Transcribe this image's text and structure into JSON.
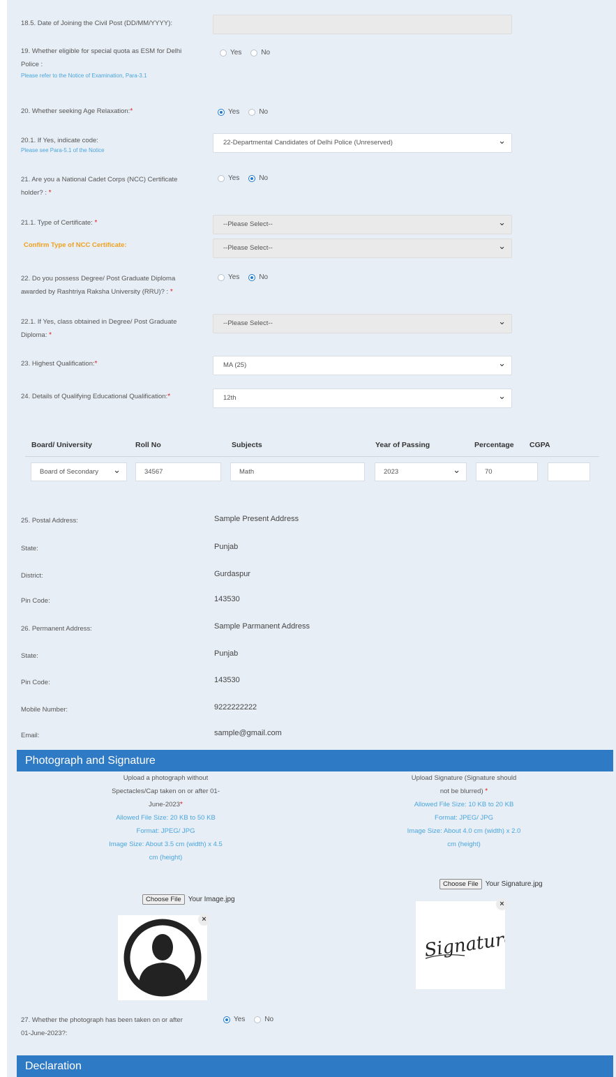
{
  "q18_5": {
    "label": "18.5. Date of Joining the Civil Post (DD/MM/YYYY):",
    "value": ""
  },
  "q19": {
    "label_line1": "19. Whether eligible for special quota as ESM for Delhi",
    "label_line2": "Police :",
    "hint": "Please refer to the Notice of Examination, Para-3.1",
    "yes": "Yes",
    "no": "No",
    "selected": "none"
  },
  "q20": {
    "label": "20. Whether seeking Age Relaxation:",
    "req": "*",
    "yes": "Yes",
    "no": "No",
    "selected": "yes"
  },
  "q20_1": {
    "label": "20.1. If Yes, indicate code:",
    "hint": "Please see Para-5.1 of the Notice",
    "value": "22-Departmental Candidates of Delhi Police (Unreserved)"
  },
  "q21": {
    "label_line1": "21. Are you a National Cadet Corps (NCC) Certificate",
    "label_line2": "holder? :",
    "req": "*",
    "yes": "Yes",
    "no": "No",
    "selected": "no"
  },
  "q21_1": {
    "label": "21.1. Type of Certificate:",
    "req": "*",
    "value": "--Please Select--"
  },
  "confirm_ncc": {
    "label": "Confirm Type of NCC Certificate:",
    "value": "--Please Select--"
  },
  "q22": {
    "label_line1": "22. Do you possess Degree/ Post Graduate Diploma",
    "label_line2": "awarded by Rashtriya Raksha University (RRU)? :",
    "req": "*",
    "yes": "Yes",
    "no": "No",
    "selected": "no"
  },
  "q22_1": {
    "label_line1": "22.1. If Yes, class obtained in Degree/ Post Graduate",
    "label_line2": "Diploma:",
    "req": "*",
    "value": "--Please Select--"
  },
  "q23": {
    "label": "23. Highest Qualification:",
    "req": "*",
    "value": "MA (25)"
  },
  "q24": {
    "label": "24. Details of Qualifying Educational Qualification:",
    "req": "*",
    "value": "12th"
  },
  "edu_table": {
    "headers": [
      "Board/ University",
      "Roll No",
      "Subjects",
      "Year of Passing",
      "Percentage",
      "CGPA"
    ],
    "row": {
      "board": "Board of Secondary",
      "roll": "34567",
      "subjects": "Math",
      "year": "2023",
      "percentage": "70",
      "cgpa": ""
    }
  },
  "address": [
    {
      "label": "25. Postal Address:",
      "value": "Sample Present Address"
    },
    {
      "label": "State:",
      "value": "Punjab"
    },
    {
      "label": "District:",
      "value": "Gurdaspur"
    },
    {
      "label": "Pin Code:",
      "value": "143530"
    },
    {
      "label": "26. Permanent Address:",
      "value": "Sample Parmanent Address"
    },
    {
      "label": "State:",
      "value": "Punjab"
    },
    {
      "label": "Pin Code:",
      "value": "143530"
    },
    {
      "label": "Mobile Number:",
      "value": "9222222222"
    },
    {
      "label": "Email:",
      "value": "sample@gmail.com"
    }
  ],
  "photo_section": {
    "title": "Photograph and Signature"
  },
  "photo_upload": {
    "line1": "Upload a photograph without",
    "line2": "Spectacles/Cap taken on or after 01-",
    "line3": "June-2023",
    "req": "*",
    "size": "Allowed File Size: 20 KB to 50 KB",
    "format": "Format: JPEG/ JPG",
    "dims1": "Image Size: About 3.5 cm (width) x 4.5",
    "dims2": "cm (height)",
    "button": "Choose File",
    "filename": "Your Image.jpg"
  },
  "sign_upload": {
    "line1": "Upload Signature (Signature should",
    "line2": "not be blurred)",
    "req": "*",
    "size": "Allowed File Size: 10 KB to 20 KB",
    "format": "Format: JPEG/ JPG",
    "dims1": "Image Size: About 4.0 cm (width) x 2.0",
    "dims2": "cm (height)",
    "button": "Choose File",
    "filename": "Your Signature.jpg",
    "signature_text": "Signature"
  },
  "q27": {
    "label_line1": "27. Whether the photograph has been taken on or after",
    "label_line2": "01-June-2023?:",
    "yes": "Yes",
    "no": "No",
    "selected": "yes"
  },
  "declaration": {
    "title": "Declaration"
  },
  "colors": {
    "accent": "#2f7ac4",
    "required": "#e02020",
    "hint": "#4aa6de",
    "ncc_label": "#f0a020",
    "background": "#e8eef6"
  }
}
